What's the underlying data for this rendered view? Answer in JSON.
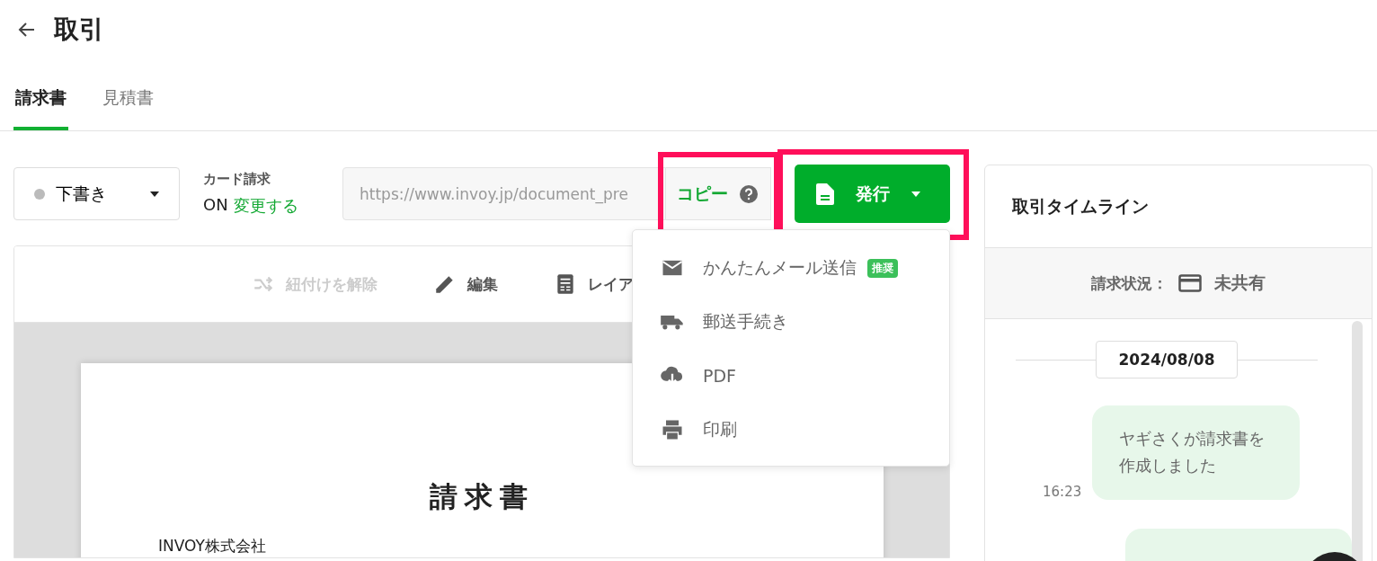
{
  "header": {
    "title": "取引"
  },
  "tabs": [
    {
      "label": "請求書",
      "selected": true
    },
    {
      "label": "見積書",
      "selected": false
    }
  ],
  "status_select": {
    "value": "下書き"
  },
  "card_billing": {
    "label": "カード請求",
    "state": "ON",
    "link": "変更する"
  },
  "share_url": {
    "value": "https://www.invoy.jp/document_pre"
  },
  "copy_button": {
    "label": "コピー",
    "highlighted": true
  },
  "issue_button": {
    "label": "発行",
    "highlighted": true
  },
  "issue_menu": {
    "items": [
      {
        "label": "かんたんメール送信",
        "badge": "推奨",
        "kind": "mail"
      },
      {
        "label": "郵送手続き",
        "kind": "truck"
      },
      {
        "label": "PDF",
        "kind": "download"
      },
      {
        "label": "印刷",
        "kind": "print"
      }
    ]
  },
  "document_toolbar": [
    {
      "label": "紐付けを解除",
      "kind": "unlink",
      "disabled": true
    },
    {
      "label": "編集",
      "kind": "edit",
      "disabled": false
    },
    {
      "label": "レイア",
      "kind": "layout",
      "disabled": false
    }
  ],
  "document": {
    "title": "請求書",
    "issuer": "INVOY株式会社"
  },
  "timeline": {
    "title": "取引タイムライン",
    "status_label": "請求状況：",
    "status_value": "未共有",
    "date": "2024/08/08",
    "events": [
      {
        "time": "16:23",
        "text": "ヤギさくが請求書を作成しました"
      }
    ]
  }
}
